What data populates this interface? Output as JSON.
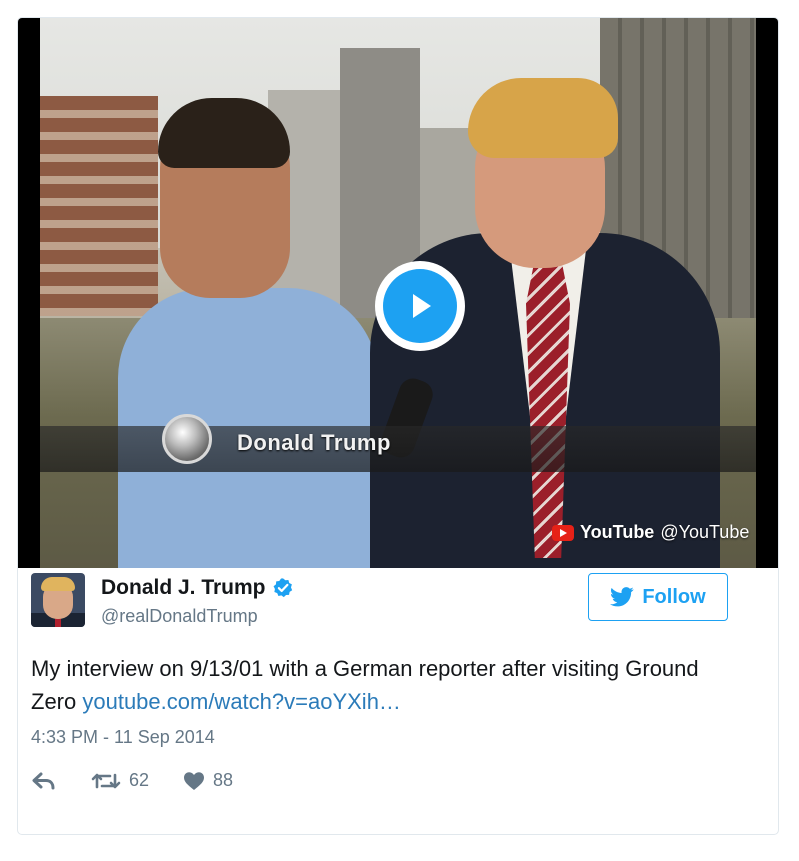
{
  "video": {
    "lower_third_name": "Donald Trump",
    "provider_name": "YouTube",
    "provider_handle": "@YouTube",
    "play_icon": "play-icon"
  },
  "tweet": {
    "display_name": "Donald J. Trump",
    "handle": "@realDonaldTrump",
    "verified_icon": "verified-badge-icon",
    "follow_label": "Follow",
    "text": "My interview on 9/13/01 with a German reporter after visiting Ground Zero ",
    "link_text": "youtube.com/watch?v=aoYXih…",
    "timestamp": "4:33 PM - 11 Sep 2014",
    "retweet_count": "62",
    "like_count": "88"
  },
  "colors": {
    "accent": "#1da1f2",
    "link": "#2b7bb9",
    "muted": "#657786",
    "text": "#14171a",
    "youtube_red": "#e62117"
  }
}
